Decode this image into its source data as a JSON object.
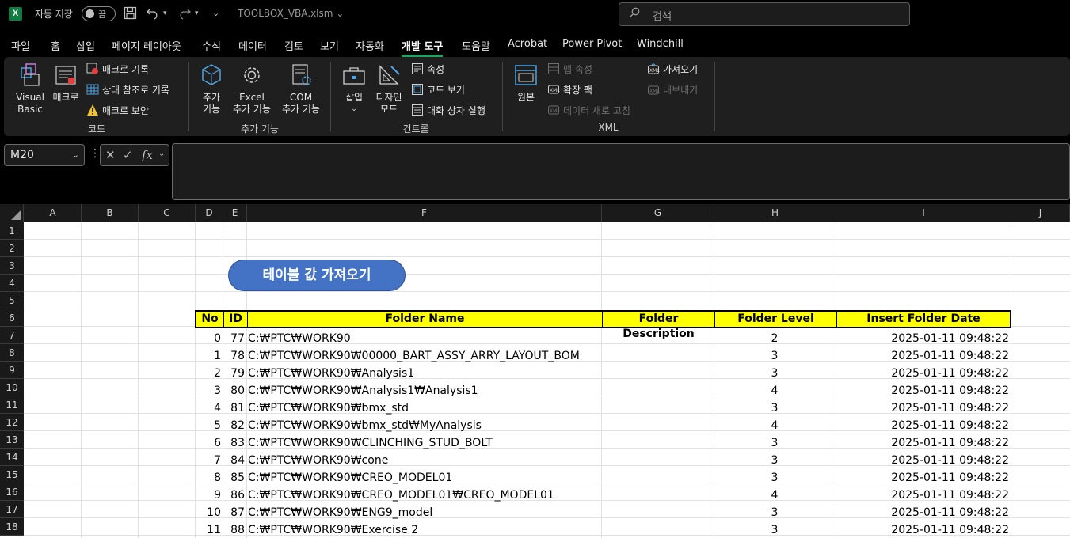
{
  "titlebar": {
    "app_logo": "X",
    "autosave_label": "자동 저장",
    "autosave_state": "끔",
    "filename": "TOOLBOX_VBA.xlsm",
    "search_placeholder": "검색"
  },
  "menu": {
    "tabs": [
      "파일",
      "홈",
      "삽입",
      "페이지 레이아웃",
      "수식",
      "데이터",
      "검토",
      "보기",
      "자동화",
      "개발 도구",
      "도움말",
      "Acrobat",
      "Power Pivot",
      "Windchill"
    ],
    "active": "개발 도구"
  },
  "ribbon": {
    "code": {
      "label": "코드",
      "visual_basic": "Visual Basic",
      "visual_basic_l1": "Visual",
      "visual_basic_l2": "Basic",
      "macros": "매크로",
      "record_macro": "매크로 기록",
      "relative_ref": "상대 참조로 기록",
      "macro_security": "매크로 보안"
    },
    "addins": {
      "label": "추가 기능",
      "addins_l1": "추가",
      "addins_l2": "기능",
      "excel_l1": "Excel",
      "excel_l2": "추가 기능",
      "com_l1": "COM",
      "com_l2": "추가 기능"
    },
    "controls": {
      "label": "컨트롤",
      "insert": "삽입",
      "design_l1": "디자인",
      "design_l2": "모드",
      "properties": "속성",
      "view_code": "코드 보기",
      "run_dialog": "대화 상자 실행"
    },
    "xml": {
      "label": "XML",
      "source": "원본",
      "map_properties": "맵 속성",
      "expansion_packs": "확장 팩",
      "refresh_data": "데이터 새로 고침",
      "import": "가져오기",
      "export": "내보내기"
    }
  },
  "formula_bar": {
    "name_box": "M20",
    "formula": ""
  },
  "grid": {
    "columns": [
      "A",
      "B",
      "C",
      "D",
      "E",
      "F",
      "G",
      "H",
      "I",
      "J"
    ],
    "rows": [
      "1",
      "2",
      "3",
      "4",
      "5",
      "6",
      "7",
      "8",
      "9",
      "10",
      "11",
      "12",
      "13",
      "14",
      "15",
      "16",
      "17",
      "18"
    ],
    "macro_button": "테이블 값 가져오기",
    "table": {
      "headers": [
        "No",
        "ID",
        "Folder Name",
        "Folder Description",
        "Folder Level",
        "Insert Folder Date"
      ],
      "rows": [
        {
          "no": "0",
          "id": "77",
          "name": "C:₩PTC₩WORK90",
          "desc": "",
          "level": "2",
          "date": "2025-01-11 09:48:22"
        },
        {
          "no": "1",
          "id": "78",
          "name": "C:₩PTC₩WORK90₩00000_BART_ASSY_ARRY_LAYOUT_BOM",
          "desc": "",
          "level": "3",
          "date": "2025-01-11 09:48:22"
        },
        {
          "no": "2",
          "id": "79",
          "name": "C:₩PTC₩WORK90₩Analysis1",
          "desc": "",
          "level": "3",
          "date": "2025-01-11 09:48:22"
        },
        {
          "no": "3",
          "id": "80",
          "name": "C:₩PTC₩WORK90₩Analysis1₩Analysis1",
          "desc": "",
          "level": "4",
          "date": "2025-01-11 09:48:22"
        },
        {
          "no": "4",
          "id": "81",
          "name": "C:₩PTC₩WORK90₩bmx_std",
          "desc": "",
          "level": "3",
          "date": "2025-01-11 09:48:22"
        },
        {
          "no": "5",
          "id": "82",
          "name": "C:₩PTC₩WORK90₩bmx_std₩MyAnalysis",
          "desc": "",
          "level": "4",
          "date": "2025-01-11 09:48:22"
        },
        {
          "no": "6",
          "id": "83",
          "name": "C:₩PTC₩WORK90₩CLINCHING_STUD_BOLT",
          "desc": "",
          "level": "3",
          "date": "2025-01-11 09:48:22"
        },
        {
          "no": "7",
          "id": "84",
          "name": "C:₩PTC₩WORK90₩cone",
          "desc": "",
          "level": "3",
          "date": "2025-01-11 09:48:22"
        },
        {
          "no": "8",
          "id": "85",
          "name": "C:₩PTC₩WORK90₩CREO_MODEL01",
          "desc": "",
          "level": "3",
          "date": "2025-01-11 09:48:22"
        },
        {
          "no": "9",
          "id": "86",
          "name": "C:₩PTC₩WORK90₩CREO_MODEL01₩CREO_MODEL01",
          "desc": "",
          "level": "4",
          "date": "2025-01-11 09:48:22"
        },
        {
          "no": "10",
          "id": "87",
          "name": "C:₩PTC₩WORK90₩ENG9_model",
          "desc": "",
          "level": "3",
          "date": "2025-01-11 09:48:22"
        },
        {
          "no": "11",
          "id": "88",
          "name": "C:₩PTC₩WORK90₩Exercise 2",
          "desc": "",
          "level": "3",
          "date": "2025-01-11 09:48:22"
        }
      ]
    }
  },
  "colors": {
    "accent": "#21a366",
    "header_fill": "#ffff00",
    "button_fill": "#4472c4"
  }
}
